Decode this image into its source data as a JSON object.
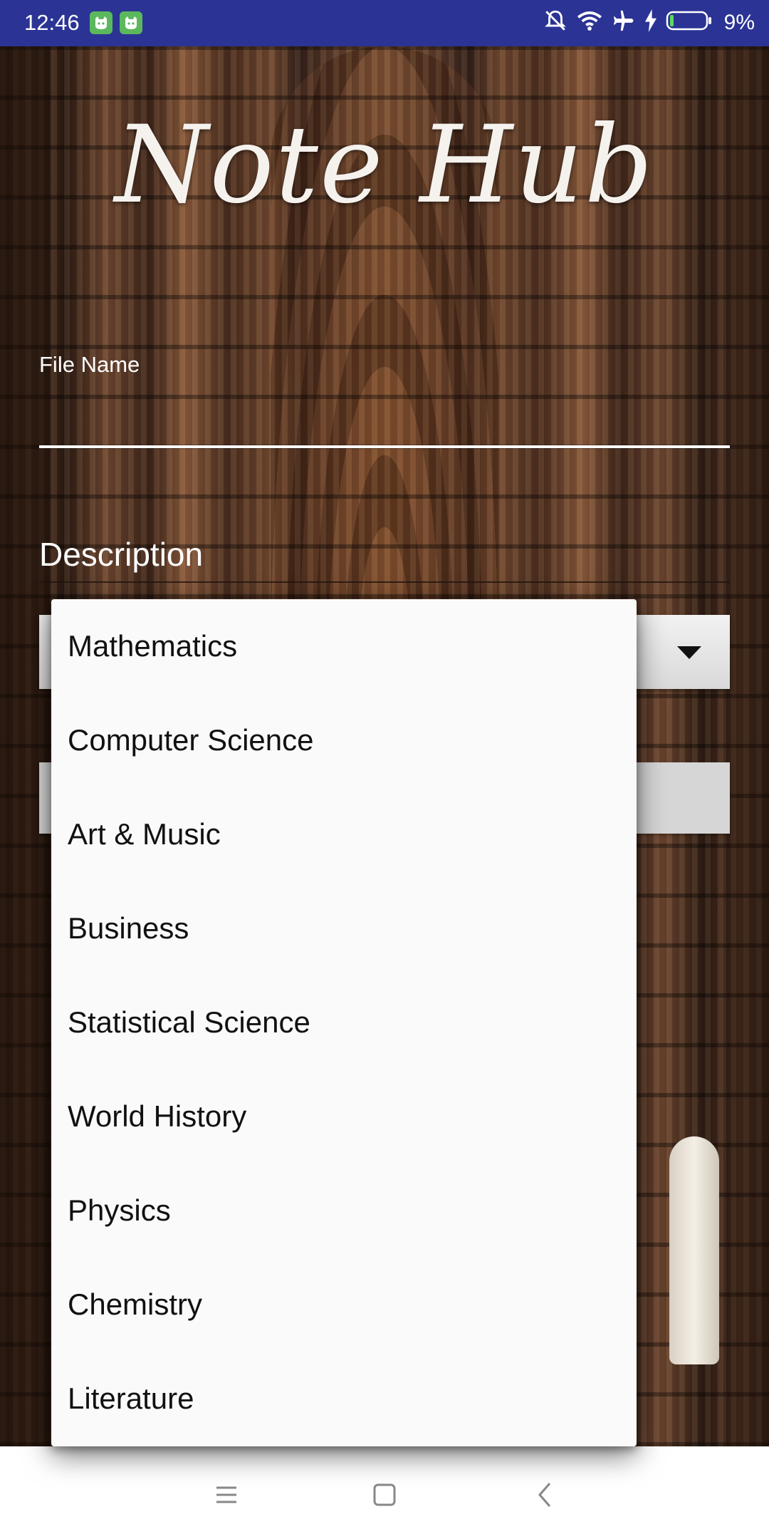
{
  "status_bar": {
    "time": "12:46",
    "battery": "9%",
    "icons": [
      "cat-notification-icon",
      "cat-notification-icon",
      "mute-icon",
      "wifi-icon",
      "airplane-icon",
      "charging-icon",
      "battery-icon"
    ]
  },
  "app": {
    "logo_text": "Note Hub"
  },
  "form": {
    "file_name_label": "File Name",
    "description_placeholder": "Description"
  },
  "dropdown": {
    "items": [
      "Mathematics",
      "Computer Science",
      "Art & Music",
      "Business",
      "Statistical Science",
      "World History",
      "Physics",
      "Chemistry",
      "Literature"
    ]
  },
  "nav_bar": {
    "buttons": [
      "menu-icon",
      "home-icon",
      "back-icon"
    ]
  },
  "colors": {
    "status_bar": "#2b3494",
    "dropdown_bg": "#fafafa",
    "notification_icon": "#5cb85c"
  }
}
